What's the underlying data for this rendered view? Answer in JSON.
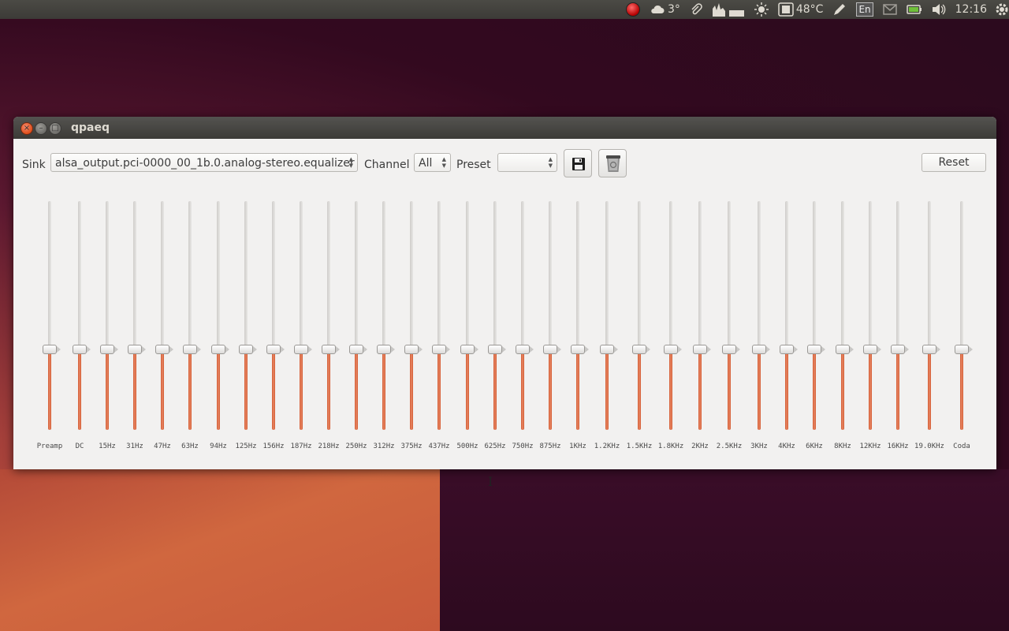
{
  "panel": {
    "weather_temp": "3°",
    "cpu_temp": "48°C",
    "keyboard_layout": "En",
    "clock": "12:16"
  },
  "window": {
    "title": "qpaeq"
  },
  "toolbar": {
    "sink_label": "Sink",
    "sink_value": "alsa_output.pci-0000_00_1b.0.analog-stereo.equalizer",
    "channel_label": "Channel",
    "channel_value": "All",
    "preset_label": "Preset",
    "preset_value": "",
    "reset_label": "Reset"
  },
  "bands": [
    {
      "label": "Preamp",
      "level": 0.35
    },
    {
      "label": "DC",
      "level": 0.35
    },
    {
      "label": "15Hz",
      "level": 0.35
    },
    {
      "label": "31Hz",
      "level": 0.35
    },
    {
      "label": "47Hz",
      "level": 0.35
    },
    {
      "label": "63Hz",
      "level": 0.35
    },
    {
      "label": "94Hz",
      "level": 0.35
    },
    {
      "label": "125Hz",
      "level": 0.35
    },
    {
      "label": "156Hz",
      "level": 0.35
    },
    {
      "label": "187Hz",
      "level": 0.35
    },
    {
      "label": "218Hz",
      "level": 0.35
    },
    {
      "label": "250Hz",
      "level": 0.35
    },
    {
      "label": "312Hz",
      "level": 0.35
    },
    {
      "label": "375Hz",
      "level": 0.35
    },
    {
      "label": "437Hz",
      "level": 0.35
    },
    {
      "label": "500Hz",
      "level": 0.35
    },
    {
      "label": "625Hz",
      "level": 0.35
    },
    {
      "label": "750Hz",
      "level": 0.35
    },
    {
      "label": "875Hz",
      "level": 0.35
    },
    {
      "label": "1KHz",
      "level": 0.35
    },
    {
      "label": "1.2KHz",
      "level": 0.35
    },
    {
      "label": "1.5KHz",
      "level": 0.35
    },
    {
      "label": "1.8KHz",
      "level": 0.35
    },
    {
      "label": "2KHz",
      "level": 0.35
    },
    {
      "label": "2.5KHz",
      "level": 0.35
    },
    {
      "label": "3KHz",
      "level": 0.35
    },
    {
      "label": "4KHz",
      "level": 0.35
    },
    {
      "label": "6KHz",
      "level": 0.35
    },
    {
      "label": "8KHz",
      "level": 0.35
    },
    {
      "label": "12KHz",
      "level": 0.35
    },
    {
      "label": "16KHz",
      "level": 0.35
    },
    {
      "label": "19.0KHz",
      "level": 0.35
    },
    {
      "label": "Coda",
      "level": 0.35
    }
  ]
}
